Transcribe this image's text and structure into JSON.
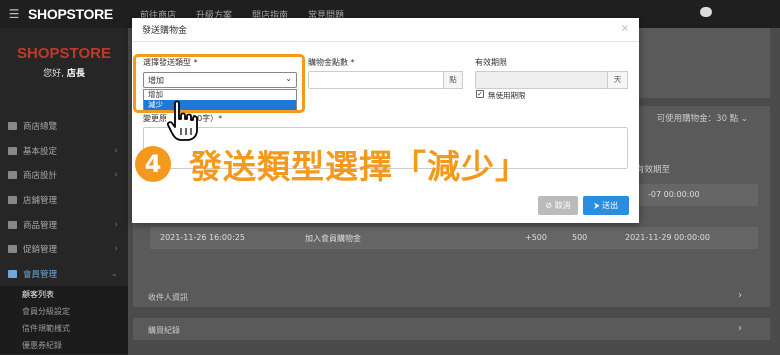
{
  "topbar": {
    "menu_icon": "hamburger-icon",
    "logo": "SHOPSTORE",
    "nav": [
      "前往商店",
      "升級方案",
      "開店指南",
      "常見問題"
    ]
  },
  "sidebar": {
    "logo": "SHOPSTORE",
    "greeting_prefix": "您好,",
    "greeting_name": "店長",
    "items": [
      {
        "label": "商店總覽",
        "icon": "dashboard-icon",
        "chev": ""
      },
      {
        "label": "基本設定",
        "icon": "bank-icon",
        "chev": "›"
      },
      {
        "label": "商店設計",
        "icon": "pen-icon",
        "chev": "›"
      },
      {
        "label": "店鋪管理",
        "icon": "lock-icon",
        "chev": ""
      },
      {
        "label": "商品管理",
        "icon": "cart-icon",
        "chev": "›"
      },
      {
        "label": "促銷管理",
        "icon": "gift-icon",
        "chev": "›"
      },
      {
        "label": "會員管理",
        "icon": "users-icon",
        "chev": "⌄"
      }
    ],
    "sub_items": [
      "顧客列表",
      "會員分級設定",
      "信件規範樣式",
      "優惠券紀錄"
    ]
  },
  "content": {
    "coupon_available": "可使用購物金：30 點 ⌄",
    "column_header": "有效期至",
    "row1_date_partial": "-07 00:00:00",
    "row2": {
      "date": "2021-11-26 16:00:25",
      "desc": "加入會員購物金",
      "amount": "+500",
      "balance": "500",
      "expiry": "2021-11-29 00:00:00"
    },
    "section_recipient": "收件人資訊",
    "section_purchase": "購買紀錄"
  },
  "modal": {
    "title": "發送購物金",
    "close": "×",
    "type_label": "選擇發送類型 *",
    "type_value": "增加",
    "options": [
      "增加",
      "減少"
    ],
    "points_label": "購物金點數 *",
    "points_unit": "點",
    "expiry_label": "有效期限",
    "expiry_unit": "天",
    "no_expiry_label": "無使用期限",
    "no_expiry_checked": true,
    "reason_label_start": "變更原",
    "reason_label_end": "30字）*",
    "cancel_label": "⊘ 取消",
    "send_label": "⮞ 送出"
  },
  "overlay": {
    "step_number": "4",
    "step_text": "發送類型選擇「減少」",
    "accent_color": "#f39a1e"
  }
}
